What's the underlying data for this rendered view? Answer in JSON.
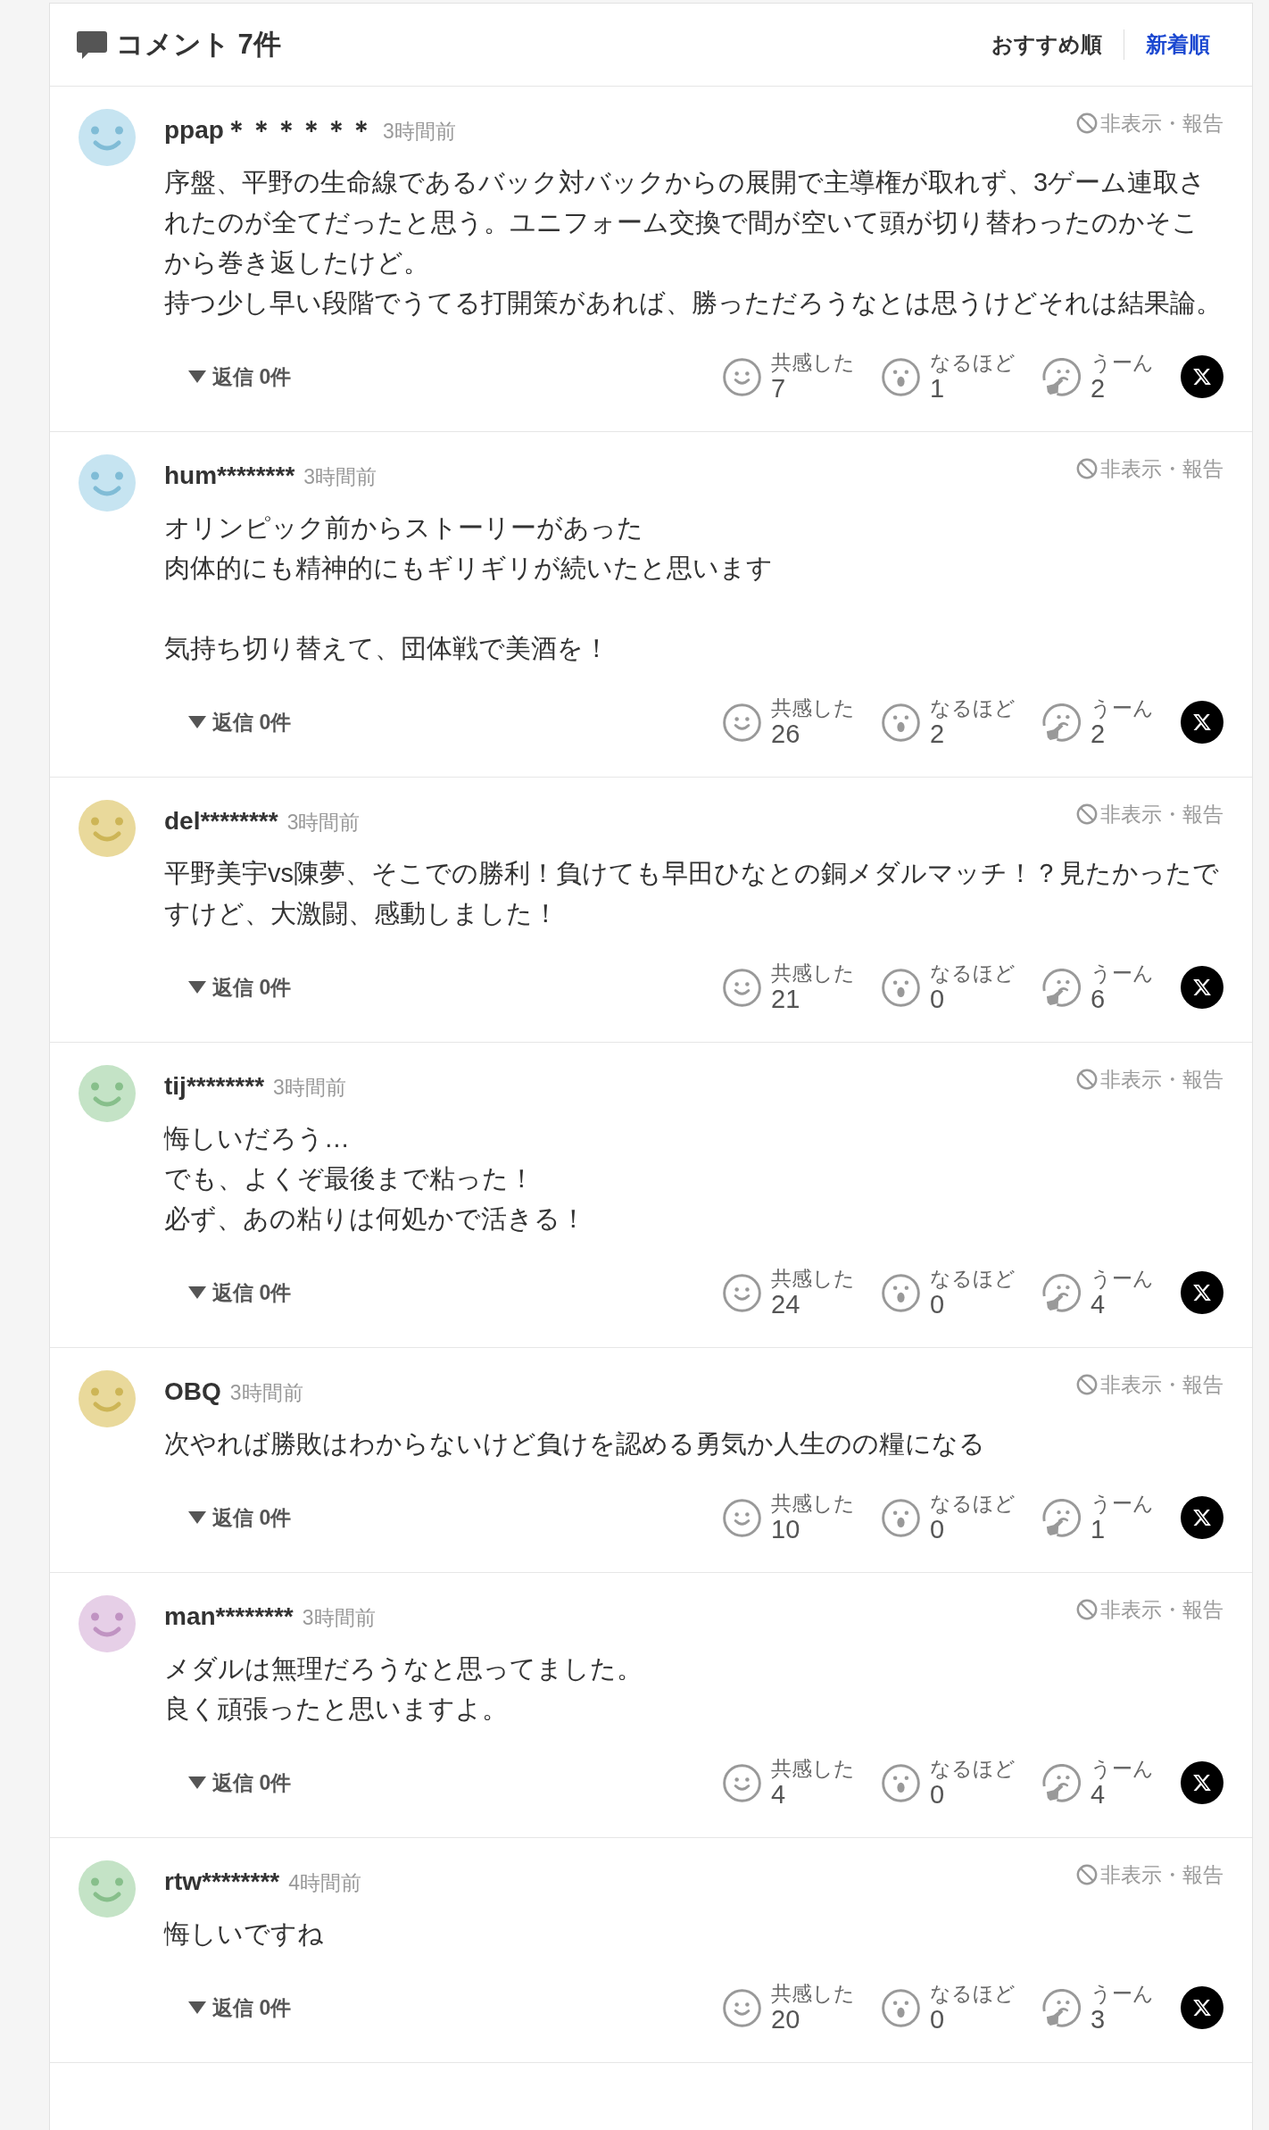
{
  "header": {
    "title": "コメント 7件",
    "sort_tabs": [
      {
        "label": "おすすめ順",
        "selected": false
      },
      {
        "label": "新着順",
        "selected": true
      }
    ]
  },
  "comments": [
    {
      "color": "#c6e4f1",
      "username": "ppap＊＊＊＊＊＊",
      "time": "3時間前",
      "report": "非表示・報告",
      "paragraphs": [
        [
          "序盤、平野の生命線であるバック対バックからの展開で主導権が取れず、3ゲーム連取されたのが全てだったと思う。ユニフォーム交換で間が空いて頭が切り替わったのかそこから巻き返したけど。",
          "持つ少し早い段階でうてる打開策があれば、勝っただろうなとは思うけどそれは結果論。"
        ]
      ],
      "replies": "返信 0件",
      "reactions": [
        {
          "kind": "empathy",
          "label": "共感した",
          "count": "7"
        },
        {
          "kind": "insight",
          "label": "なるほど",
          "count": "1"
        },
        {
          "kind": "hmm",
          "label": "うーん",
          "count": "2"
        }
      ]
    },
    {
      "color": "#c6e4f1",
      "username": "hum********",
      "time": "3時間前",
      "report": "非表示・報告",
      "paragraphs": [
        [
          "オリンピック前からストーリーがあった",
          "肉体的にも精神的にもギリギリが続いたと思います"
        ],
        [
          "気持ち切り替えて、団体戦で美酒を！"
        ]
      ],
      "replies": "返信 0件",
      "reactions": [
        {
          "kind": "empathy",
          "label": "共感した",
          "count": "26"
        },
        {
          "kind": "insight",
          "label": "なるほど",
          "count": "2"
        },
        {
          "kind": "hmm",
          "label": "うーん",
          "count": "2"
        }
      ]
    },
    {
      "color": "#e9d99b",
      "username": "del********",
      "time": "3時間前",
      "report": "非表示・報告",
      "paragraphs": [
        [
          "平野美宇vs陳夢、そこでの勝利！負けても早田ひなとの銅メダルマッチ！？見たかったですけど、大激闘、感動しました！"
        ]
      ],
      "replies": "返信 0件",
      "reactions": [
        {
          "kind": "empathy",
          "label": "共感した",
          "count": "21"
        },
        {
          "kind": "insight",
          "label": "なるほど",
          "count": "0"
        },
        {
          "kind": "hmm",
          "label": "うーん",
          "count": "6"
        }
      ]
    },
    {
      "color": "#c4e3c6",
      "username": "tij********",
      "time": "3時間前",
      "report": "非表示・報告",
      "paragraphs": [
        [
          "悔しいだろう…",
          "でも、よくぞ最後まで粘った！",
          "必ず、あの粘りは何処かで活きる！"
        ]
      ],
      "replies": "返信 0件",
      "reactions": [
        {
          "kind": "empathy",
          "label": "共感した",
          "count": "24"
        },
        {
          "kind": "insight",
          "label": "なるほど",
          "count": "0"
        },
        {
          "kind": "hmm",
          "label": "うーん",
          "count": "4"
        }
      ]
    },
    {
      "color": "#e9d99b",
      "username": "OBQ",
      "time": "3時間前",
      "report": "非表示・報告",
      "paragraphs": [
        [
          "次やれば勝敗はわからないけど負けを認める勇気か人生のの糧になる"
        ]
      ],
      "replies": "返信 0件",
      "reactions": [
        {
          "kind": "empathy",
          "label": "共感した",
          "count": "10"
        },
        {
          "kind": "insight",
          "label": "なるほど",
          "count": "0"
        },
        {
          "kind": "hmm",
          "label": "うーん",
          "count": "1"
        }
      ]
    },
    {
      "color": "#e6cfe7",
      "username": "man********",
      "time": "3時間前",
      "report": "非表示・報告",
      "paragraphs": [
        [
          "メダルは無理だろうなと思ってました。",
          "良く頑張ったと思いますよ。"
        ]
      ],
      "replies": "返信 0件",
      "reactions": [
        {
          "kind": "empathy",
          "label": "共感した",
          "count": "4"
        },
        {
          "kind": "insight",
          "label": "なるほど",
          "count": "0"
        },
        {
          "kind": "hmm",
          "label": "うーん",
          "count": "4"
        }
      ]
    },
    {
      "color": "#c4e3c6",
      "username": "rtw********",
      "time": "4時間前",
      "report": "非表示・報告",
      "paragraphs": [
        [
          "悔しいですね"
        ]
      ],
      "replies": "返信 0件",
      "reactions": [
        {
          "kind": "empathy",
          "label": "共感した",
          "count": "20"
        },
        {
          "kind": "insight",
          "label": "なるほど",
          "count": "0"
        },
        {
          "kind": "hmm",
          "label": "うーん",
          "count": "3"
        }
      ]
    }
  ]
}
